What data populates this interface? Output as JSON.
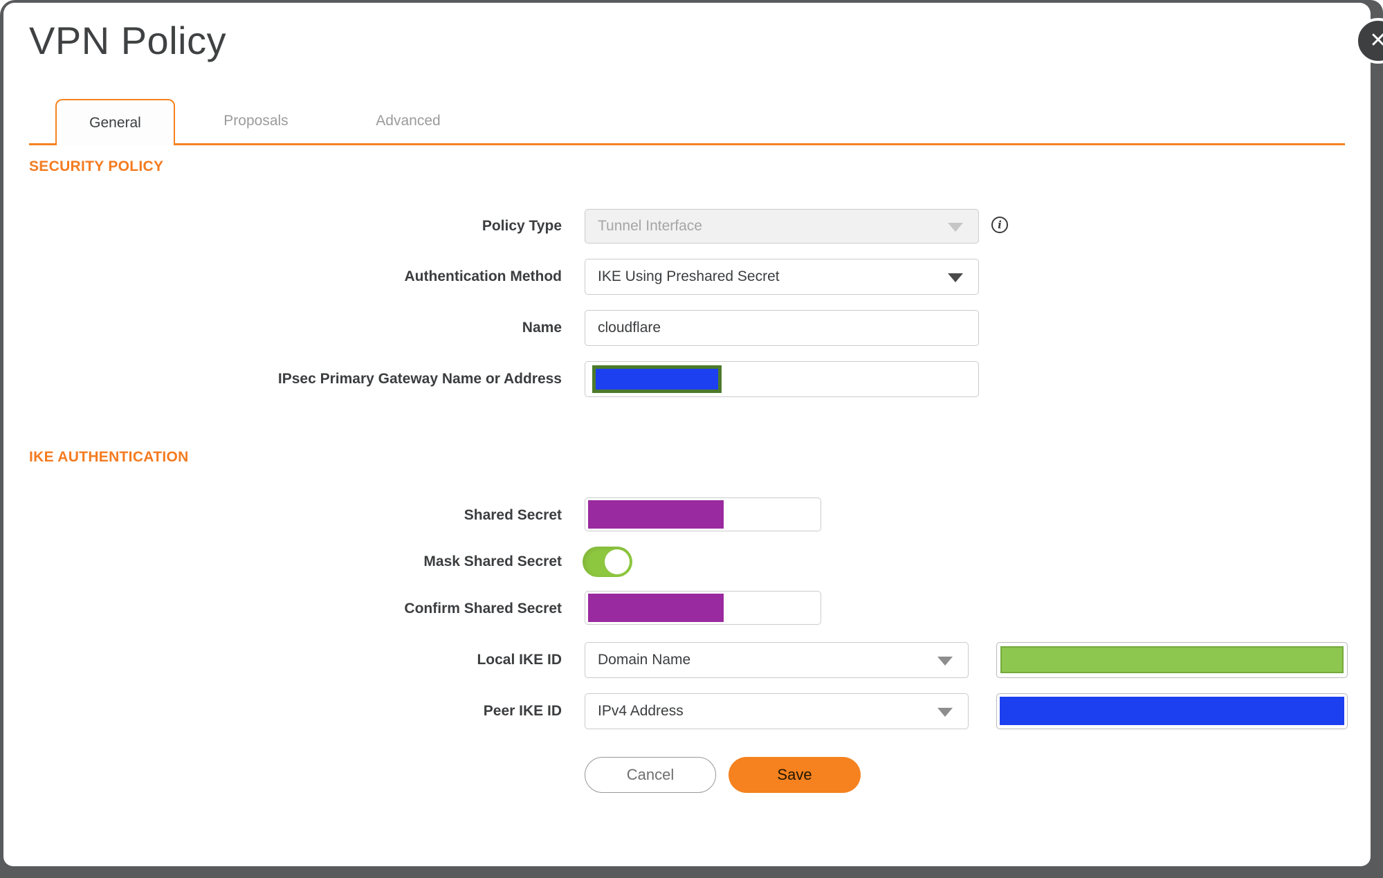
{
  "colors": {
    "accent_orange": "#F5821F",
    "heading_orange": "#F47B20",
    "label_color": "#3B3D3F",
    "muted_gray": "#9B9B9B",
    "border_gray": "#CBCBCB",
    "frame_gray": "#595A5C",
    "close_bg": "#3D3F41",
    "redact_purple": "#9A2A9F",
    "redact_blue": "#1C3FF0",
    "redact_green": "#8DC74F",
    "redact_green_border": "#75A93C",
    "redact_olive_border": "#4C7A2B",
    "toggle_green": "#8DC63F"
  },
  "dialog": {
    "title": "VPN Policy"
  },
  "close": {
    "glyph": "✕"
  },
  "tabs": [
    {
      "label": "General",
      "active": true
    },
    {
      "label": "Proposals",
      "active": false
    },
    {
      "label": "Advanced",
      "active": false
    }
  ],
  "security_policy": {
    "heading": "SECURITY POLICY",
    "policy_type": {
      "label": "Policy Type",
      "value": "Tunnel Interface",
      "disabled": true
    },
    "auth_method": {
      "label": "Authentication Method",
      "value": "IKE Using Preshared Secret"
    },
    "name": {
      "label": "Name",
      "value": "cloudflare"
    },
    "gateway": {
      "label": "IPsec Primary Gateway Name or Address",
      "value_redacted": "blue-block"
    }
  },
  "ike_authentication": {
    "heading": "IKE AUTHENTICATION",
    "shared_secret": {
      "label": "Shared Secret",
      "value_redacted": "purple-block"
    },
    "mask_shared_secret": {
      "label": "Mask Shared Secret",
      "state": "on"
    },
    "confirm_shared_secret": {
      "label": "Confirm Shared Secret",
      "value_redacted": "purple-block"
    },
    "local_ike_id": {
      "label": "Local IKE ID",
      "type": "Domain Name",
      "value_redacted": "green-block"
    },
    "peer_ike_id": {
      "label": "Peer IKE ID",
      "type": "IPv4 Address",
      "value_redacted": "blue-block"
    }
  },
  "actions": {
    "cancel": "Cancel",
    "save": "Save"
  }
}
